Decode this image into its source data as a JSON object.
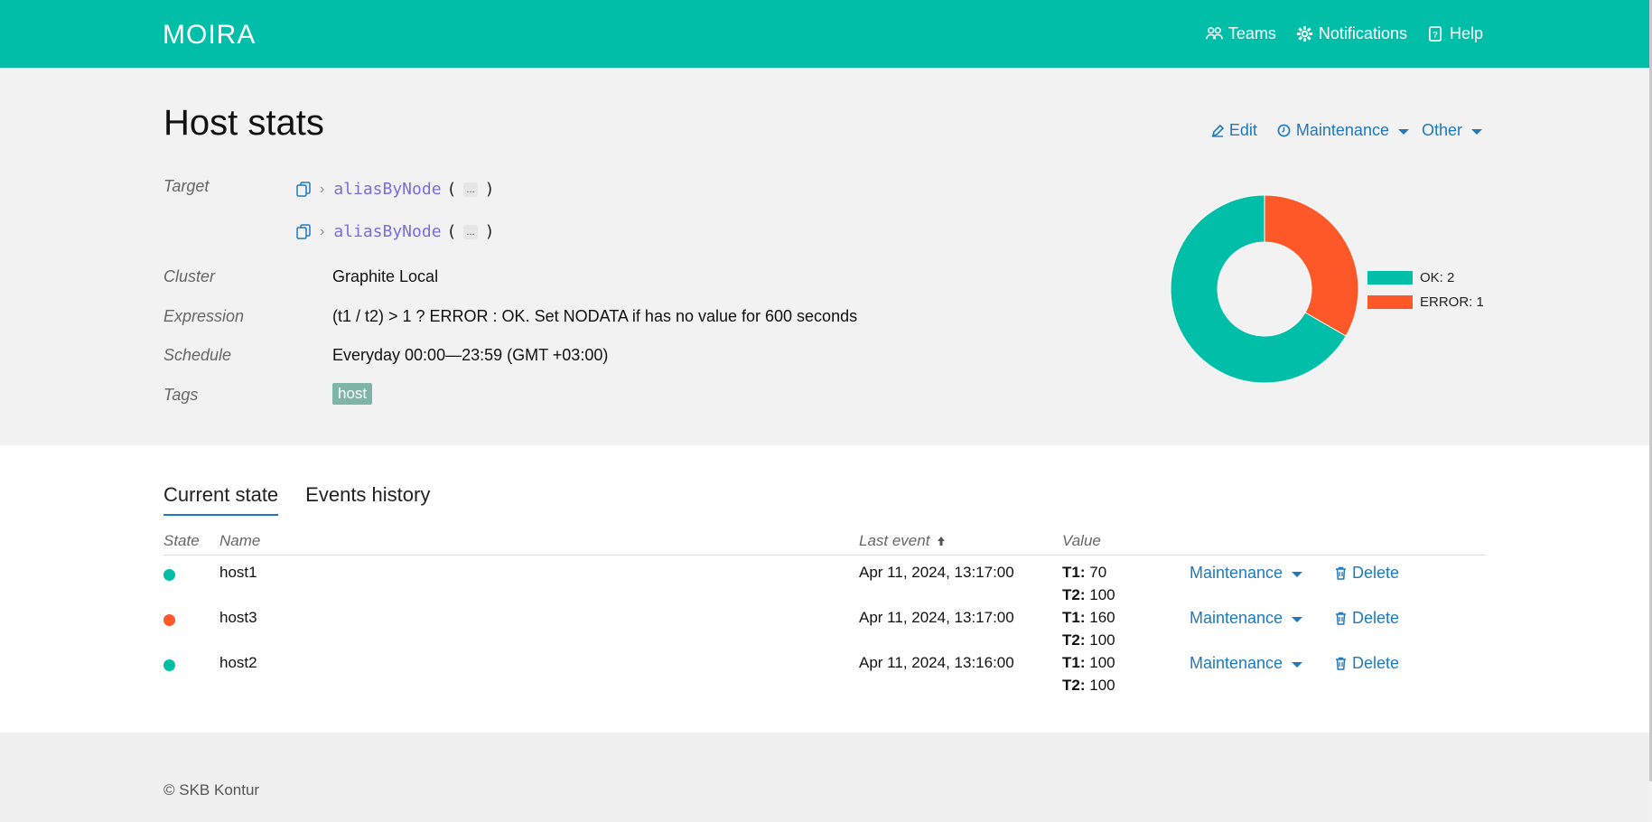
{
  "header": {
    "logo_text": "MOIRA",
    "nav": [
      {
        "label": "Teams",
        "icon": "teams-icon"
      },
      {
        "label": "Notifications",
        "icon": "gear-icon"
      },
      {
        "label": "Help",
        "icon": "help-icon"
      }
    ],
    "color": "#00bea8"
  },
  "trigger": {
    "title": "Host stats",
    "actions": {
      "edit": "Edit",
      "maintenance": "Maintenance",
      "other": "Other"
    },
    "labels": {
      "target": "Target",
      "cluster": "Cluster",
      "expression": "Expression",
      "schedule": "Schedule",
      "tags": "Tags"
    },
    "targets": [
      {
        "fn": "aliasByNode",
        "open": "(",
        "dots": "...",
        "close": ")"
      },
      {
        "fn": "aliasByNode",
        "open": "(",
        "dots": "...",
        "close": ")"
      }
    ],
    "cluster": "Graphite Local",
    "expression": "(t1 / t2) > 1 ? ERROR : OK. Set NODATA if has no value for 600 seconds",
    "schedule": "Everyday 00:00—23:59 (GMT +03:00)",
    "tags": [
      "host"
    ]
  },
  "chart_data": {
    "type": "pie",
    "categories": [
      "OK",
      "ERROR"
    ],
    "values": [
      2,
      1
    ],
    "colors": [
      "#00bea8",
      "#fe5828"
    ],
    "legend": [
      "OK: 2",
      "ERROR: 1"
    ],
    "legend_position": "right"
  },
  "tabs": [
    {
      "label": "Current state",
      "active": true
    },
    {
      "label": "Events history",
      "active": false
    }
  ],
  "table": {
    "headers": {
      "state": "State",
      "name": "Name",
      "last_event": "Last event",
      "value": "Value"
    },
    "rows": [
      {
        "state": "OK",
        "color": "#00bea8",
        "name": "host1",
        "last_event": "Apr 11, 2024, 13:17:00",
        "t1_label": "T1:",
        "t1": "70",
        "t2_label": "T2:",
        "t2": "100",
        "maintenance": "Maintenance",
        "delete": "Delete"
      },
      {
        "state": "ERROR",
        "color": "#fe5828",
        "name": "host3",
        "last_event": "Apr 11, 2024, 13:17:00",
        "t1_label": "T1:",
        "t1": "160",
        "t2_label": "T2:",
        "t2": "100",
        "maintenance": "Maintenance",
        "delete": "Delete"
      },
      {
        "state": "OK",
        "color": "#00bea8",
        "name": "host2",
        "last_event": "Apr 11, 2024, 13:16:00",
        "t1_label": "T1:",
        "t1": "100",
        "t2_label": "T2:",
        "t2": "100",
        "maintenance": "Maintenance",
        "delete": "Delete"
      }
    ]
  },
  "footer": {
    "copyright": "© SKB Kontur"
  },
  "colors": {
    "accent": "#00bea8",
    "link": "#1e79be",
    "error": "#fe5828"
  }
}
